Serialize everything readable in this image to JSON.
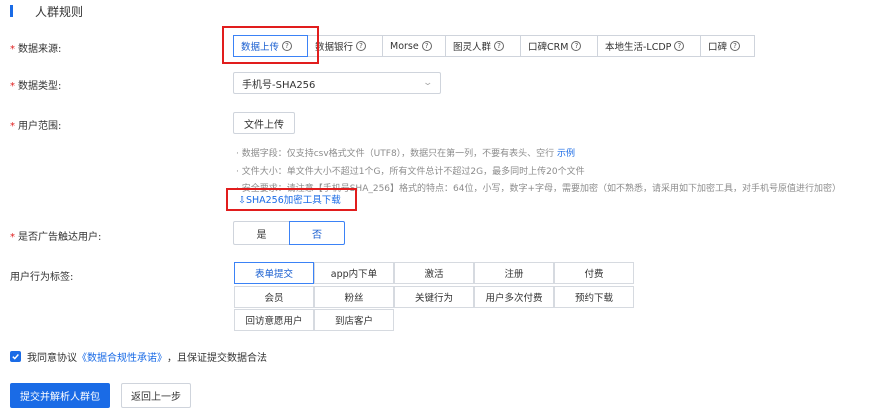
{
  "section": {
    "title": "人群规则"
  },
  "required_mark": "*",
  "labels": {
    "data_source": "数据来源:",
    "data_type": "数据类型:",
    "user_scope": "用户范围:",
    "ad_reach": "是否广告触达用户:",
    "behavior_tags": "用户行为标签:"
  },
  "sources": [
    {
      "label": "数据上传",
      "help": "?"
    },
    {
      "label": "数据银行",
      "help": "?"
    },
    {
      "label": "Morse",
      "help": "?"
    },
    {
      "label": "图灵人群",
      "help": "?"
    },
    {
      "label": "口碑CRM",
      "help": "?"
    },
    {
      "label": "本地生活-LCDP",
      "help": "?"
    },
    {
      "label": "口碑",
      "help": "?"
    }
  ],
  "data_type": {
    "selected": "手机号-SHA256"
  },
  "upload_button": "文件上传",
  "hints": {
    "line1_prefix": "· 数据字段：仅支持csv格式文件（UTF8），数据只在第一列，不要有表头、空行 ",
    "line1_link": "示例",
    "line2": "· 文件大小：单文件大小不超过1个G，所有文件总计不超过2G，最多同时上传20个文件",
    "line3": "· 安全要求：请注意【手机号SHA_256】格式的特点：64位，小写，数字+字母，需要加密（如不熟悉，请采用如下加密工具，对手机号原值进行加密）"
  },
  "download_link": "⇩SHA256加密工具下载",
  "ad_reach": {
    "yes": "是",
    "no": "否"
  },
  "tags": [
    "表单提交",
    "app内下单",
    "激活",
    "注册",
    "付费",
    "会员",
    "粉丝",
    "关键行为",
    "用户多次付费",
    "预约下载",
    "回访意愿用户",
    "到店客户"
  ],
  "agreement": {
    "prefix": "我同意协议",
    "link": "《数据合规性承诺》",
    "suffix": "，且保证提交数据合法"
  },
  "buttons": {
    "submit": "提交并解析人群包",
    "back": "返回上一步"
  },
  "colors": {
    "accent": "#1a6be6",
    "highlight": "#e11d1d"
  }
}
